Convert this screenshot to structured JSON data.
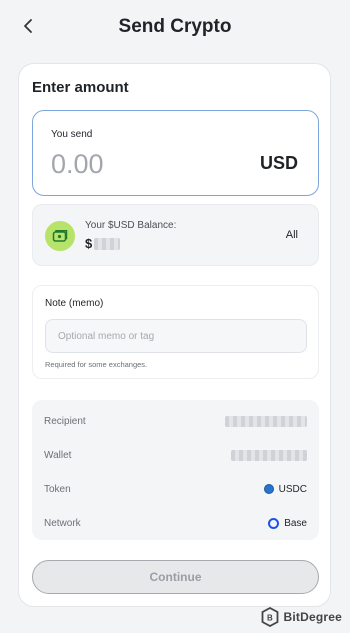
{
  "header": {
    "title": "Send Crypto",
    "back_icon": "chevron-left-icon"
  },
  "card": {
    "title": "Enter amount",
    "send": {
      "label": "You send",
      "amount": "0.00",
      "currency": "USD"
    },
    "balance": {
      "label": "Your $USD Balance:",
      "value_prefix": "$",
      "all_label": "All",
      "icon": "wallet-icon",
      "icon_bg": "#b7e36b"
    },
    "memo": {
      "label": "Note (memo)",
      "placeholder": "Optional memo or tag",
      "value": "",
      "help": "Required for some exchanges."
    },
    "details": {
      "rows": [
        {
          "label": "Recipient"
        },
        {
          "label": "Wallet"
        },
        {
          "label": "Token",
          "value": "USDC",
          "icon": "usdc-icon"
        },
        {
          "label": "Network",
          "value": "Base",
          "icon": "base-icon"
        }
      ]
    },
    "continue_label": "Continue"
  },
  "watermark": {
    "text": "BitDegree"
  },
  "colors": {
    "accent_border": "#7da5dd",
    "usdc": "#2775ca",
    "base": "#1b53f0"
  }
}
